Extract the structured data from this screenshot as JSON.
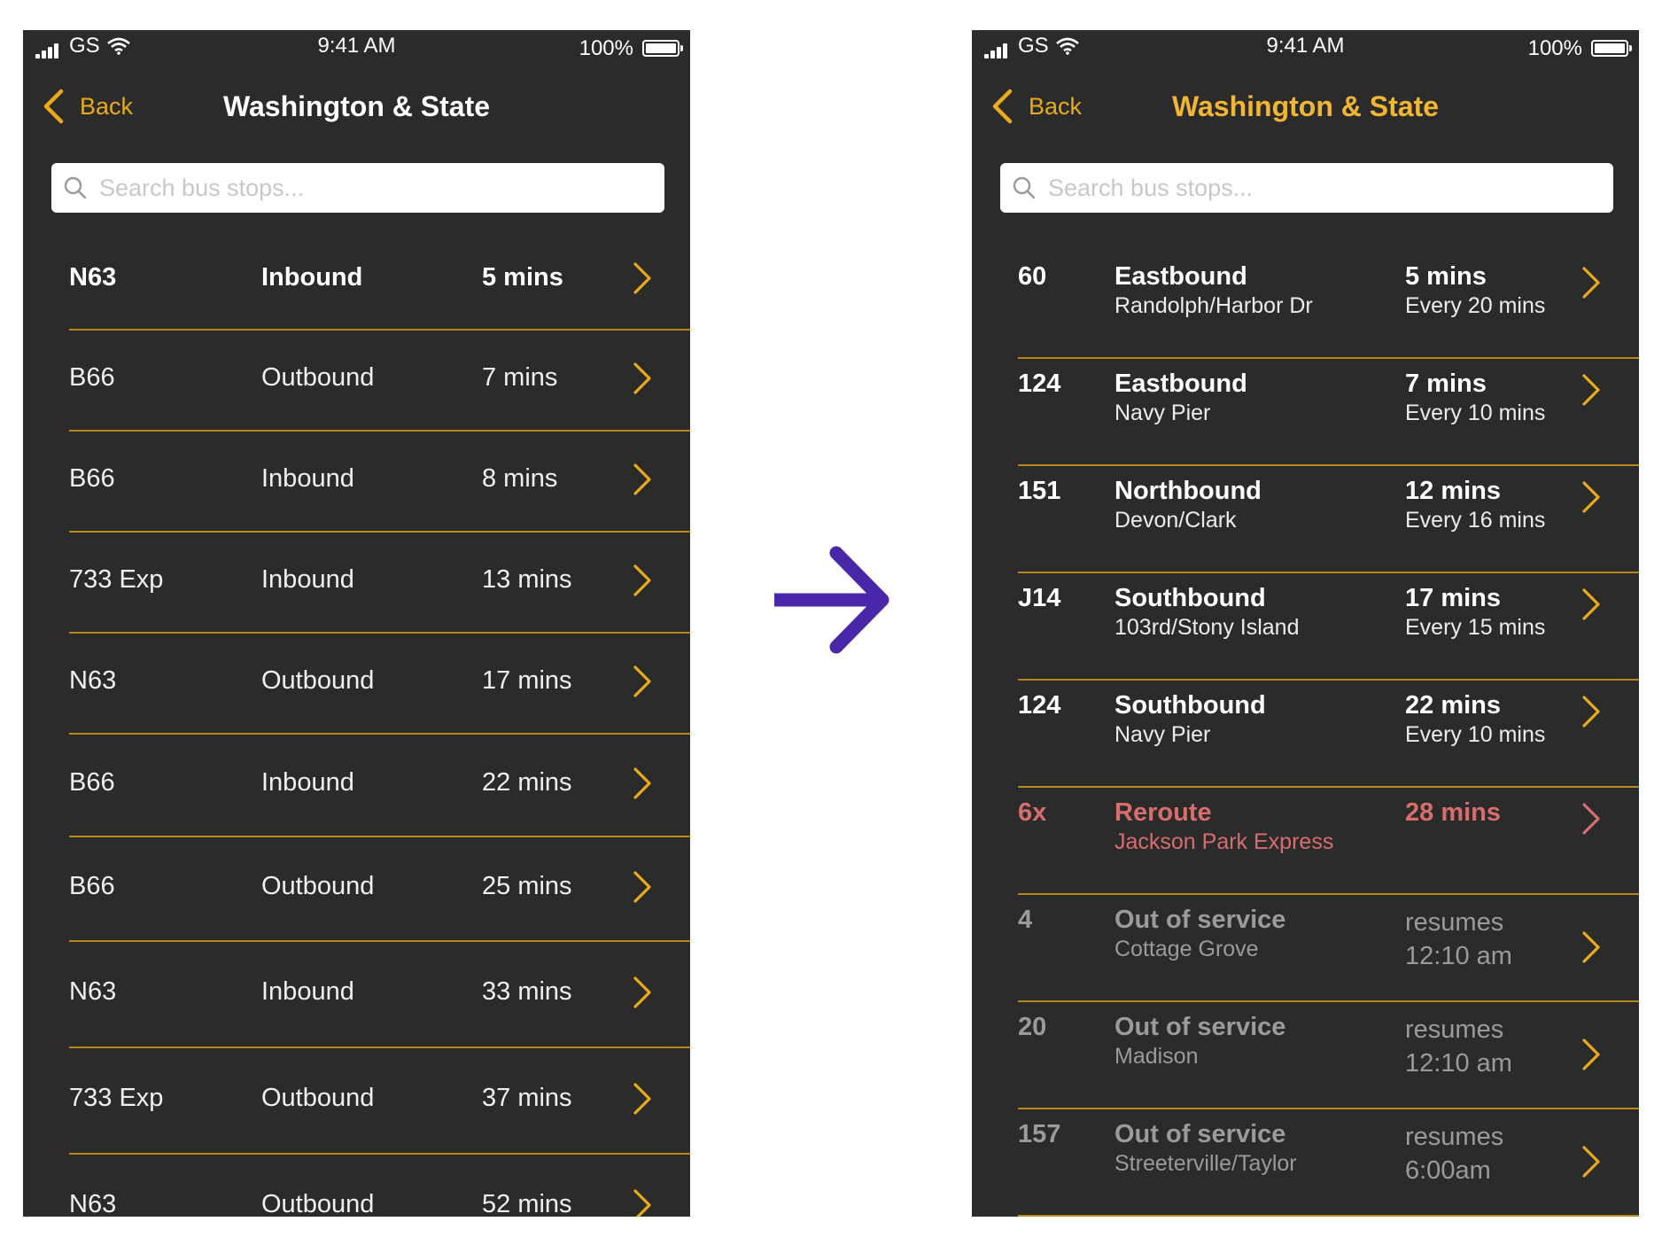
{
  "colors": {
    "background": "#2b2b2b",
    "accent": "#e9ab1a",
    "divider": "#b7891a",
    "reroute": "#d86d6d",
    "out_of_service": "#9b9b9b",
    "transition_arrow": "#4a27a8"
  },
  "status_bar": {
    "carrier": "GS",
    "time": "9:41 AM",
    "battery": "100%"
  },
  "icons": {
    "signal": "signal-bars-icon",
    "wifi": "wifi-icon",
    "battery": "battery-icon",
    "back": "chevron-left-icon",
    "search": "search-icon",
    "row": "chevron-right-icon",
    "transition": "arrow-right-icon"
  },
  "left": {
    "back_label": "Back",
    "title": "Washington & State",
    "search_placeholder": "Search bus stops...",
    "rows": [
      {
        "route": "N63",
        "direction": "Inbound",
        "eta": "5 mins"
      },
      {
        "route": "B66",
        "direction": "Outbound",
        "eta": "7 mins"
      },
      {
        "route": "B66",
        "direction": "Inbound",
        "eta": "8 mins"
      },
      {
        "route": "733 Exp",
        "direction": "Inbound",
        "eta": "13 mins"
      },
      {
        "route": "N63",
        "direction": "Outbound",
        "eta": "17 mins"
      },
      {
        "route": "B66",
        "direction": "Inbound",
        "eta": "22 mins"
      },
      {
        "route": "B66",
        "direction": "Outbound",
        "eta": "25 mins"
      },
      {
        "route": "N63",
        "direction": "Inbound",
        "eta": "33 mins"
      },
      {
        "route": "733 Exp",
        "direction": "Outbound",
        "eta": "37 mins"
      },
      {
        "route": "N63",
        "direction": "Outbound",
        "eta": "52 mins"
      }
    ]
  },
  "right": {
    "back_label": "Back",
    "title": "Washington & State",
    "search_placeholder": "Search bus stops...",
    "rows": [
      {
        "route": "60",
        "status": "Eastbound",
        "destination": "Randolph/Harbor Dr",
        "eta": "5 mins",
        "frequency": "Every 20 mins"
      },
      {
        "route": "124",
        "status": "Eastbound",
        "destination": "Navy Pier",
        "eta": "7 mins",
        "frequency": "Every 10 mins"
      },
      {
        "route": "151",
        "status": "Northbound",
        "destination": "Devon/Clark",
        "eta": "12 mins",
        "frequency": "Every 16 mins"
      },
      {
        "route": "J14",
        "status": "Southbound",
        "destination": "103rd/Stony Island",
        "eta": "17 mins",
        "frequency": "Every 15 mins"
      },
      {
        "route": "124",
        "status": "Southbound",
        "destination": "Navy Pier",
        "eta": "22 mins",
        "frequency": "Every 10 mins"
      },
      {
        "route": "6x",
        "status": "Reroute",
        "destination": "Jackson Park Express",
        "eta": "28 mins"
      },
      {
        "route": "4",
        "status": "Out of service",
        "destination": "Cottage Grove",
        "resumes": "resumes 12:10 am"
      },
      {
        "route": "20",
        "status": "Out of service",
        "destination": "Madison",
        "resumes": "resumes 12:10 am"
      },
      {
        "route": "157",
        "status": "Out of service",
        "destination": "Streeterville/Taylor",
        "resumes": "resumes 6:00am"
      }
    ]
  }
}
